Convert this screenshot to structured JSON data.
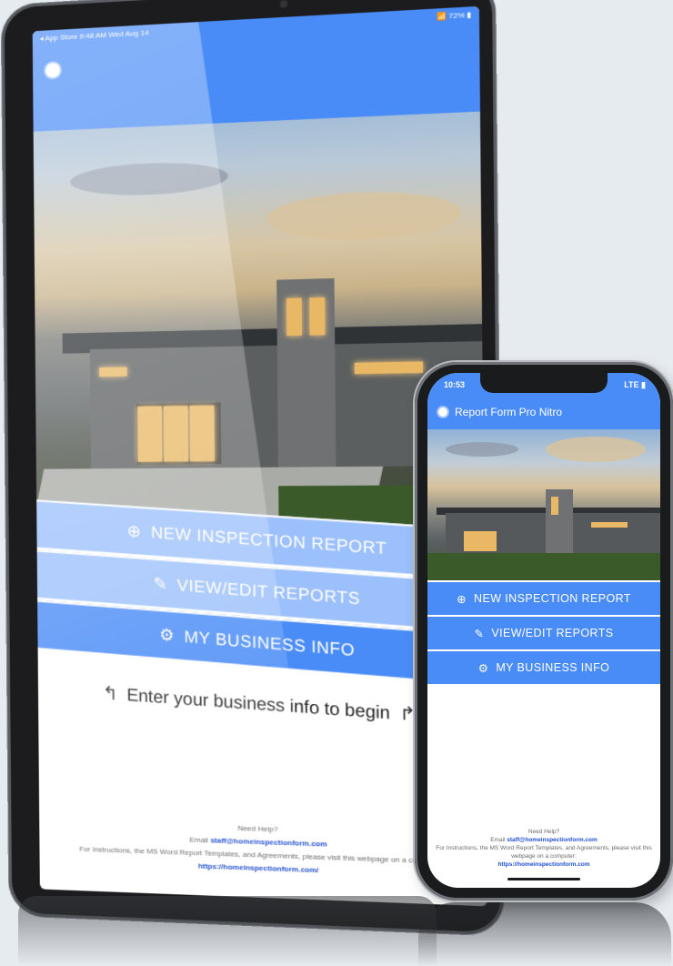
{
  "tablet": {
    "status_bar": {
      "left": "◂ App Store  9:48 AM  Wed Aug 14",
      "right": "📶 72% ▮"
    },
    "buttons": {
      "new_inspection": "NEW INSPECTION REPORT",
      "view_edit": "VIEW/EDIT REPORTS",
      "business_info": "MY BUSINESS INFO"
    },
    "hint": "Enter your business info to begin",
    "footer": {
      "need_help": "Need Help?",
      "email_prefix": "Email",
      "email": "staff@homeinspectionform.com",
      "instructions": "For Instructions, the MS Word Report Templates, and Agreements, please visit this webpage on a computer:",
      "url": "https://homeinspectionform.com/"
    }
  },
  "phone": {
    "status_bar": {
      "time": "10:53",
      "right": "LTE ▮"
    },
    "app_title": "Report Form Pro Nitro",
    "buttons": {
      "new_inspection": "NEW INSPECTION REPORT",
      "view_edit": "VIEW/EDIT REPORTS",
      "business_info": "MY BUSINESS INFO"
    },
    "footer": {
      "need_help": "Need Help?",
      "email_prefix": "Email",
      "email": "staff@homeinspectionform.com",
      "instructions": "For Instructions, the MS Word Report Templates, and Agreements, please visit this webpage on a computer:",
      "url": "https://homeinspectionform.com"
    }
  },
  "icons": {
    "plus": "plus-circle-icon",
    "pencil": "pencil-icon",
    "gear": "gear-icon"
  },
  "colors": {
    "primary_blue": "#4a8cf7",
    "light_blue": "#9cc0fb",
    "link": "#1f4fd1",
    "background": "#e6ebef"
  }
}
